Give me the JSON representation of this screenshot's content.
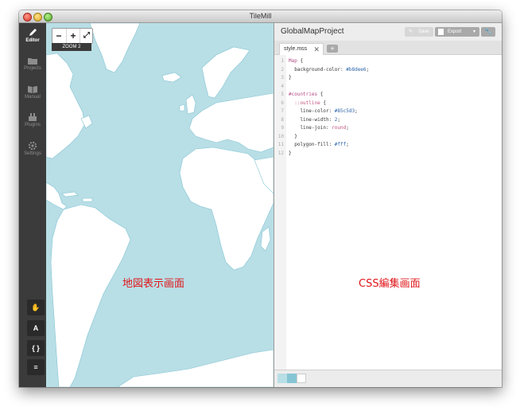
{
  "window": {
    "title": "TileMill"
  },
  "sidebar": {
    "items": [
      {
        "label": "Editor",
        "icon": "pencil-icon",
        "active": true
      },
      {
        "label": "Projects",
        "icon": "folder-icon",
        "active": false
      },
      {
        "label": "Manual",
        "icon": "book-icon",
        "active": false
      },
      {
        "label": "Plugins",
        "icon": "plugin-icon",
        "active": false
      },
      {
        "label": "Settings",
        "icon": "gear-icon",
        "active": false
      }
    ],
    "tools": [
      {
        "icon": "hand-icon",
        "glyph": "✋"
      },
      {
        "icon": "font-icon",
        "glyph": "A"
      },
      {
        "icon": "braces-icon",
        "glyph": "{ }"
      },
      {
        "icon": "layers-icon",
        "glyph": "≡"
      }
    ]
  },
  "map": {
    "zoom_out": "−",
    "zoom_in": "+",
    "fullscreen": "⤢",
    "zoom_label": "ZOOM 2",
    "caption": "地図表示画面",
    "colors": {
      "water": "#b8dee6",
      "land": "#ffffff",
      "outline": "#85c5d3"
    }
  },
  "editor": {
    "project_title": "GlobalMapProject",
    "save_label": "Save",
    "export_label": "Export",
    "tab_label": "style.mss",
    "tab_close": "✕",
    "add_tab": "+",
    "caption": "CSS編集画面",
    "code": [
      {
        "n": "1",
        "parts": [
          [
            "sel",
            "Map"
          ],
          [
            "punct",
            " {"
          ]
        ]
      },
      {
        "n": "2",
        "parts": [
          [
            "prop",
            "  background-color: "
          ],
          [
            "val",
            "#b8dee6"
          ],
          [
            "punct",
            ";"
          ]
        ]
      },
      {
        "n": "3",
        "parts": [
          [
            "punct",
            "}"
          ]
        ]
      },
      {
        "n": "4",
        "parts": []
      },
      {
        "n": "5",
        "parts": [
          [
            "sel",
            "#countries"
          ],
          [
            "punct",
            " {"
          ]
        ]
      },
      {
        "n": "6",
        "parts": [
          [
            "kw",
            "  ::outline"
          ],
          [
            "punct",
            " {"
          ]
        ]
      },
      {
        "n": "7",
        "parts": [
          [
            "prop",
            "    line-color: "
          ],
          [
            "val",
            "#85c5d3"
          ],
          [
            "punct",
            ";"
          ]
        ]
      },
      {
        "n": "8",
        "parts": [
          [
            "prop",
            "    line-width: "
          ],
          [
            "val",
            "2"
          ],
          [
            "punct",
            ";"
          ]
        ]
      },
      {
        "n": "9",
        "parts": [
          [
            "prop",
            "    line-join: "
          ],
          [
            "kw",
            "round"
          ],
          [
            "punct",
            ";"
          ]
        ]
      },
      {
        "n": "10",
        "parts": [
          [
            "punct",
            "  }"
          ]
        ]
      },
      {
        "n": "11",
        "parts": [
          [
            "prop",
            "  polygon-fill: "
          ],
          [
            "val",
            "#fff"
          ],
          [
            "punct",
            ";"
          ]
        ]
      },
      {
        "n": "12",
        "parts": [
          [
            "punct",
            "}"
          ]
        ]
      }
    ],
    "swatches": [
      "#b8dee6",
      "#85c5d3",
      "#ffffff"
    ]
  }
}
